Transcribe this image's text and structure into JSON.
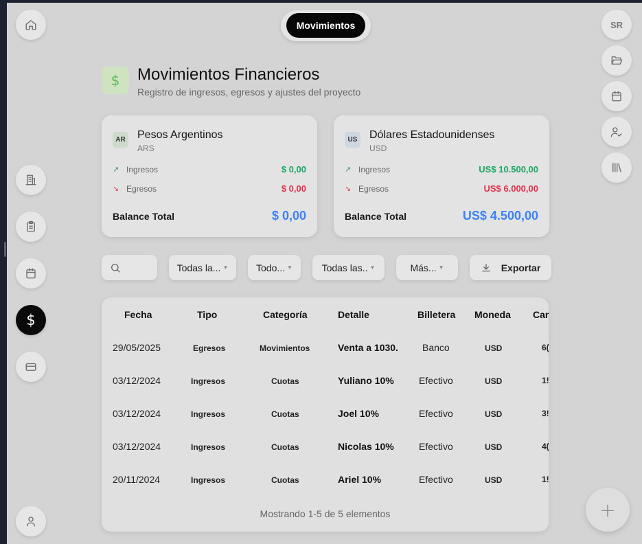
{
  "nav": {
    "top_tab": "Movimientos",
    "user_initials": "SR",
    "fab_symbol": "+",
    "active_symbol": "$"
  },
  "header": {
    "icon_symbol": "$",
    "title": "Movimientos Financieros",
    "subtitle": "Registro de ingresos, egresos y ajustes del proyecto"
  },
  "cards": [
    {
      "badge": "AR",
      "name": "Pesos Argentinos",
      "code": "ARS",
      "income_label": "Ingresos",
      "income_value": "$ 0,00",
      "expense_label": "Egresos",
      "expense_value": "$ 0,00",
      "total_label": "Balance Total",
      "total_value": "$ 0,00"
    },
    {
      "badge": "US",
      "name": "Dólares Estadounidenses",
      "code": "USD",
      "income_label": "Ingresos",
      "income_value": "US$ 10.500,00",
      "expense_label": "Egresos",
      "expense_value": "US$ 6.000,00",
      "total_label": "Balance Total",
      "total_value": "US$ 4.500,00"
    }
  ],
  "filters": {
    "f1": "Todas la...",
    "f2": "Todo...",
    "f3": "Todas las..",
    "f4": "Más...",
    "export": "Exportar"
  },
  "table": {
    "headers": [
      "Fecha",
      "Tipo",
      "Categoría",
      "Detalle",
      "Billetera",
      "Moneda",
      "Can"
    ],
    "rows": [
      {
        "fecha": "29/05/2025",
        "tipo": "Egresos",
        "categoria": "Movimientos",
        "detalle": "Venta a 1030.",
        "billetera": "Banco",
        "moneda": "USD",
        "cantidad": "6("
      },
      {
        "fecha": "03/12/2024",
        "tipo": "Ingresos",
        "categoria": "Cuotas",
        "detalle": "Yuliano 10%",
        "billetera": "Efectivo",
        "moneda": "USD",
        "cantidad": "1!"
      },
      {
        "fecha": "03/12/2024",
        "tipo": "Ingresos",
        "categoria": "Cuotas",
        "detalle": "Joel 10%",
        "billetera": "Efectivo",
        "moneda": "USD",
        "cantidad": "3!"
      },
      {
        "fecha": "03/12/2024",
        "tipo": "Ingresos",
        "categoria": "Cuotas",
        "detalle": "Nicolas 10%",
        "billetera": "Efectivo",
        "moneda": "USD",
        "cantidad": "4("
      },
      {
        "fecha": "20/11/2024",
        "tipo": "Ingresos",
        "categoria": "Cuotas",
        "detalle": "Ariel 10%",
        "billetera": "Efectivo",
        "moneda": "USD",
        "cantidad": "1!"
      }
    ],
    "footer": "Mostrando 1-5 de 5 elementos"
  }
}
